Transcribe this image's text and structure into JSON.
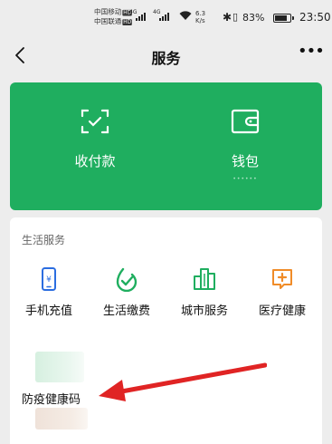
{
  "status_bar": {
    "carrier_1": "中国移动",
    "carrier_2": "中国联通",
    "hd_badge": "HD",
    "network_1": "4G",
    "network_2": "4G",
    "speed_value": "6.3",
    "speed_unit": "K/s",
    "battery_percent": "83%",
    "battery_level": 0.83,
    "time": "23:50"
  },
  "nav": {
    "title": "服务",
    "back_icon": "chevron-left-icon",
    "more_label": "•••"
  },
  "pay_card": {
    "background": "#1fae5f",
    "items": [
      {
        "label": "收付款",
        "icon": "scan-check-icon"
      },
      {
        "label": "钱包",
        "icon": "wallet-icon",
        "sub": "••••••"
      }
    ]
  },
  "life_services": {
    "section_title": "生活服务",
    "items": [
      {
        "label": "手机充值",
        "icon": "phone-yen-icon",
        "color": "#2b6de0"
      },
      {
        "label": "生活缴费",
        "icon": "check-drop-icon",
        "color": "#1fae5f"
      },
      {
        "label": "城市服务",
        "icon": "city-buildings-icon",
        "color": "#1fae5f"
      },
      {
        "label": "医疗健康",
        "icon": "medical-plus-icon",
        "color": "#f08c28"
      }
    ],
    "health_code_label": "防疫健康码"
  },
  "annotation": {
    "arrow_color": "#e02424"
  }
}
